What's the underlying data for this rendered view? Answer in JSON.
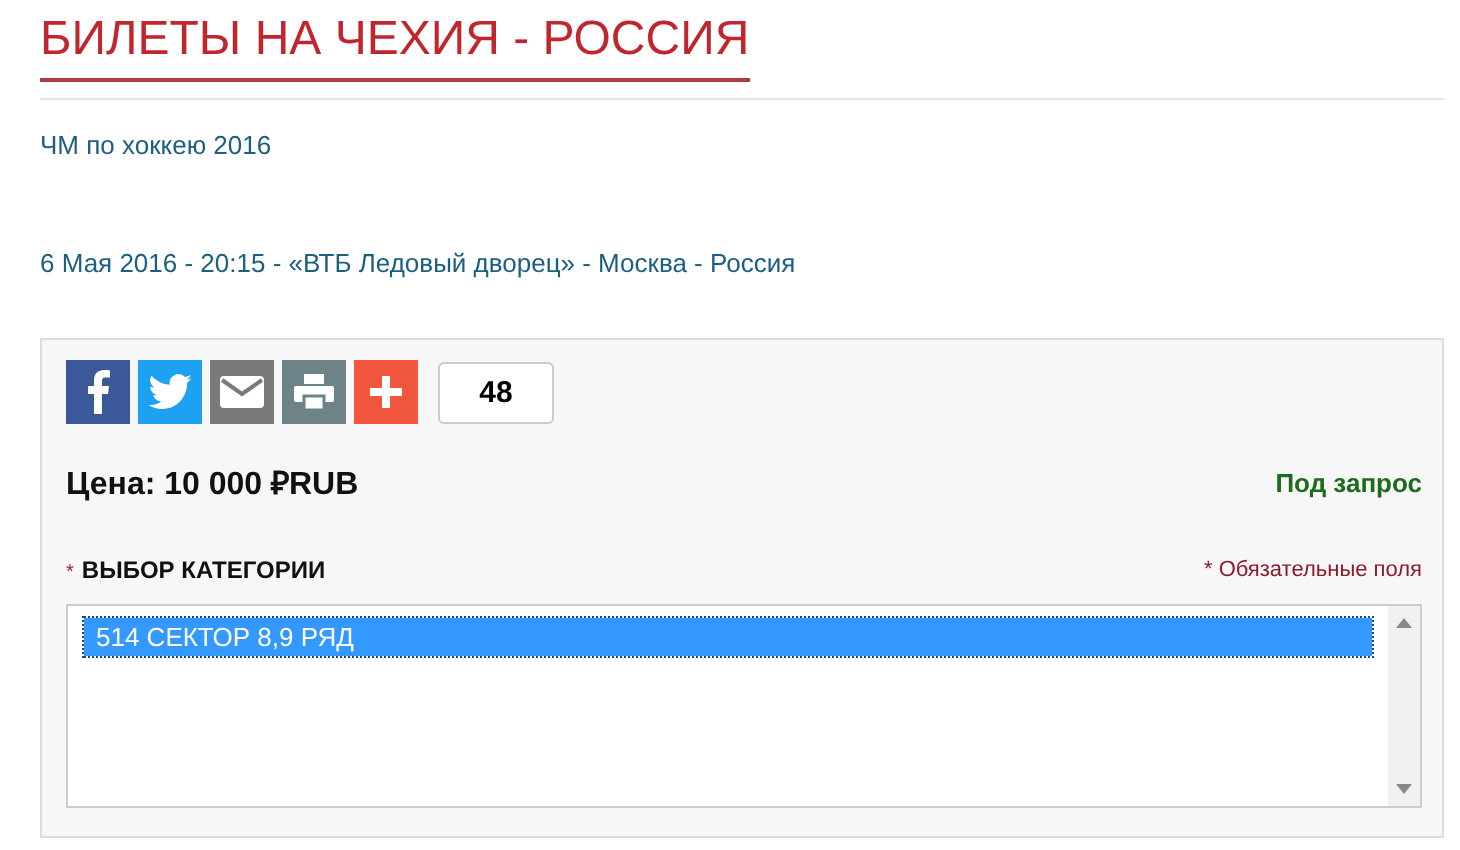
{
  "title": "БИЛЕТЫ НА ЧЕХИЯ - РОССИЯ",
  "event_link": "ЧМ по хоккею 2016",
  "event_details": "6 Мая 2016 - 20:15 - «ВТБ Ледовый дворец» - Москва - Россия",
  "share_buttons": [
    {
      "kind": "facebook"
    },
    {
      "kind": "twitter"
    },
    {
      "kind": "email"
    },
    {
      "kind": "print"
    },
    {
      "kind": "plus"
    }
  ],
  "share_count": "48",
  "price": "Цена: 10 000 ₽RUB",
  "availability": "Под запрос",
  "category_field": {
    "required_mark": "*",
    "label": "ВЫБОР КАТЕГОРИИ",
    "required_note": "* Обязательные поля",
    "options": [
      {
        "label": "514 СЕКТОР 8,9 РЯД",
        "selected": true
      }
    ]
  }
}
